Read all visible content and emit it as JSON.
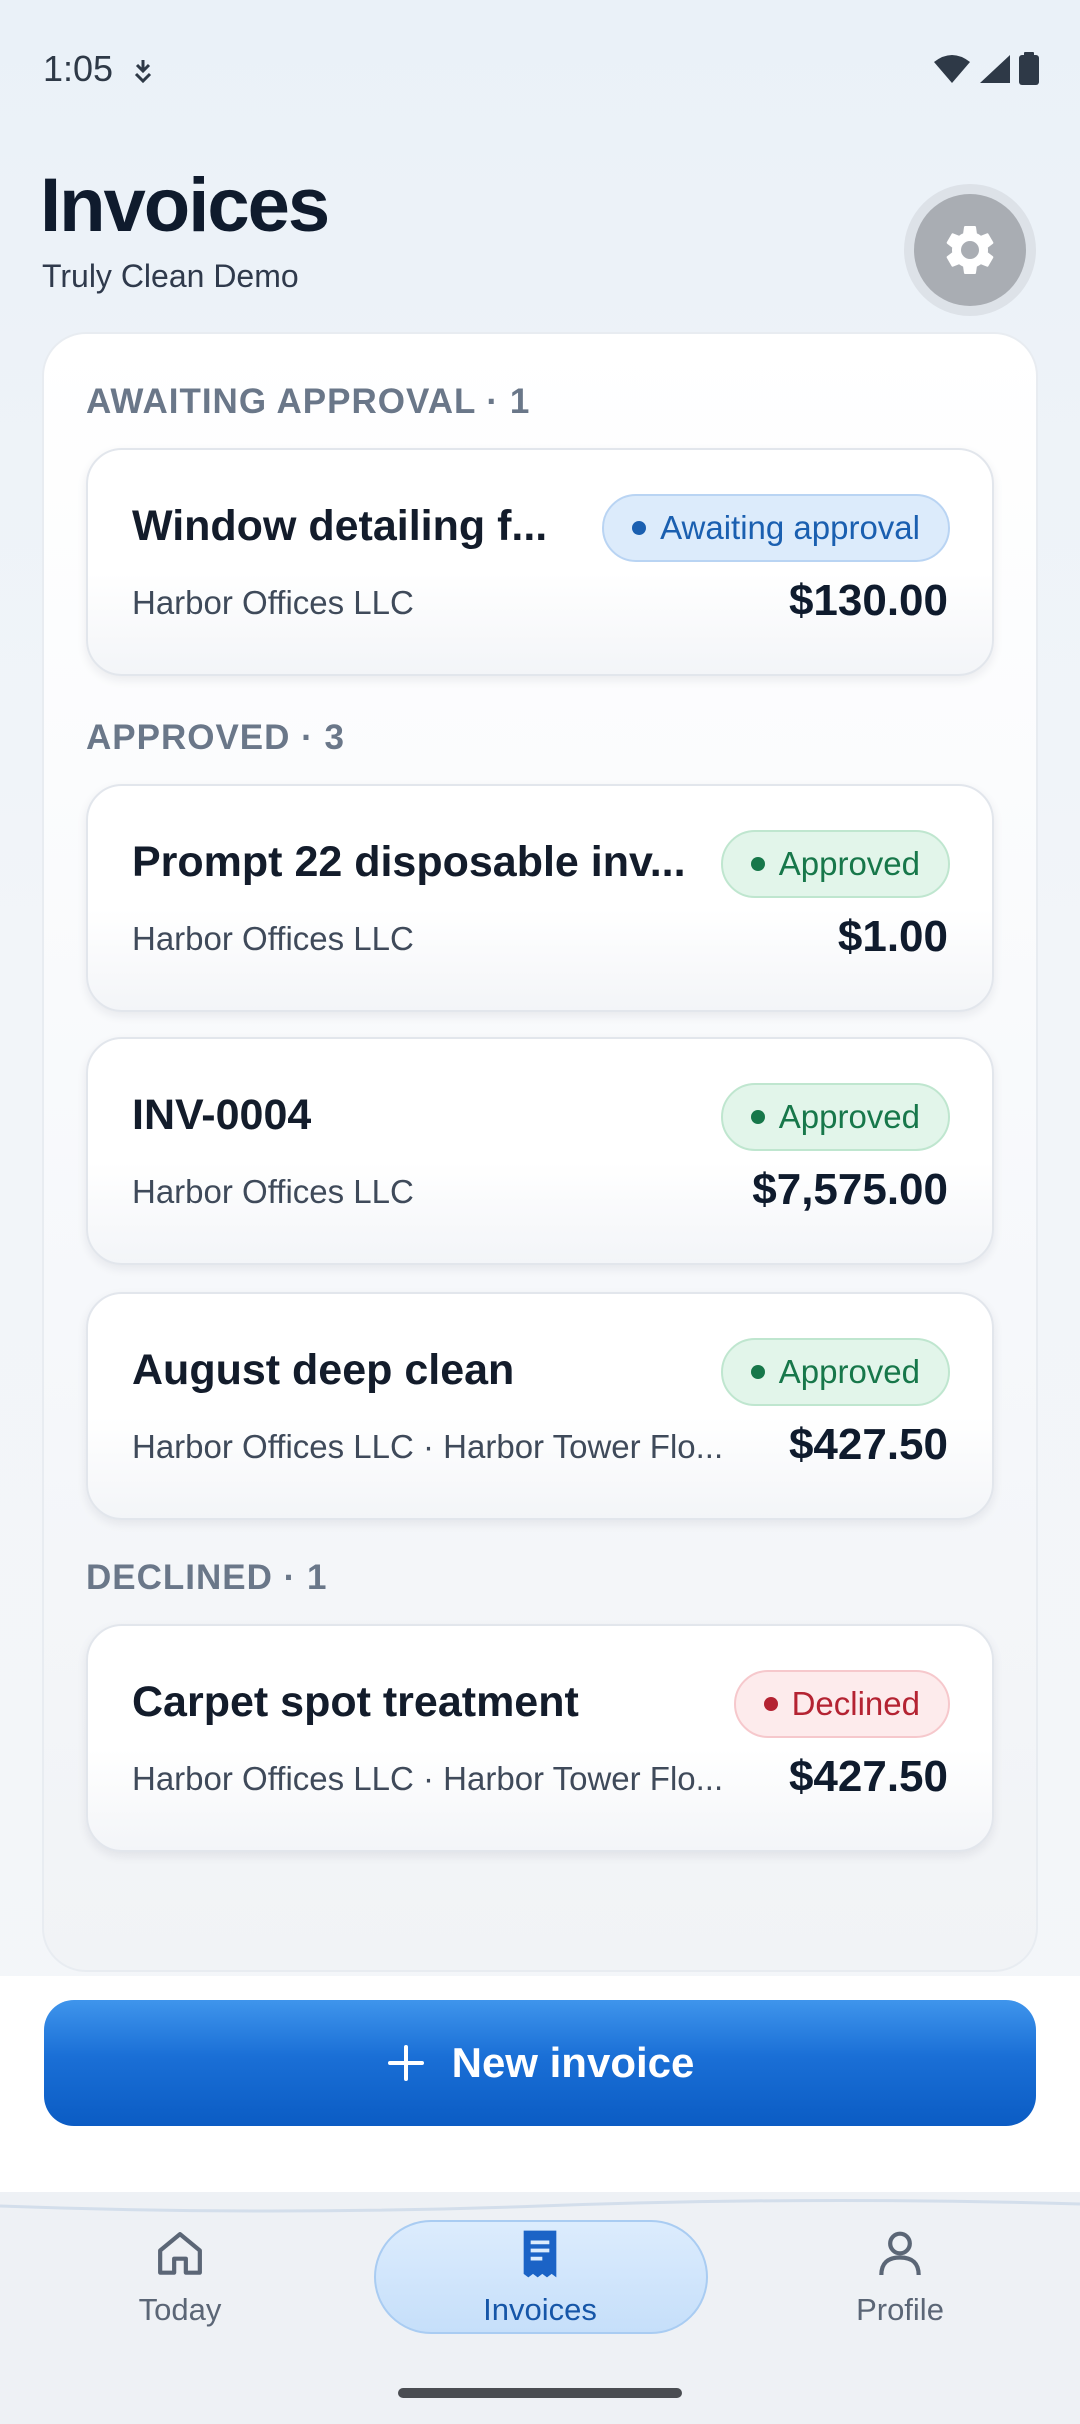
{
  "status_bar": {
    "time": "1:05"
  },
  "header": {
    "title": "Invoices",
    "subtitle": "Truly Clean Demo"
  },
  "sections": [
    {
      "label": "AWAITING APPROVAL · 1"
    },
    {
      "label": "APPROVED · 3"
    },
    {
      "label": "DECLINED · 1"
    }
  ],
  "invoices": [
    {
      "title": "Window detailing f...",
      "client": "Harbor Offices LLC",
      "amount": "$130.00",
      "status": "Awaiting approval"
    },
    {
      "title": "Prompt 22 disposable inv...",
      "client": "Harbor Offices LLC",
      "amount": "$1.00",
      "status": "Approved"
    },
    {
      "title": "INV-0004",
      "client": "Harbor Offices LLC",
      "amount": "$7,575.00",
      "status": "Approved"
    },
    {
      "title": "August deep clean",
      "client": "Harbor Offices LLC · Harbor Tower Flo...",
      "amount": "$427.50",
      "status": "Approved"
    },
    {
      "title": "Carpet spot treatment",
      "client": "Harbor Offices LLC · Harbor Tower Flo...",
      "amount": "$427.50",
      "status": "Declined"
    }
  ],
  "actions": {
    "new_invoice_label": "New invoice"
  },
  "nav": {
    "items": [
      {
        "label": "Today",
        "icon": "home-icon"
      },
      {
        "label": "Invoices",
        "icon": "receipt-icon"
      },
      {
        "label": "Profile",
        "icon": "person-icon"
      }
    ],
    "active": "Invoices"
  },
  "colors": {
    "accent": "#1a6fd6",
    "awaiting": "#1a5fb0",
    "approved": "#17774a",
    "declined": "#b42332"
  }
}
